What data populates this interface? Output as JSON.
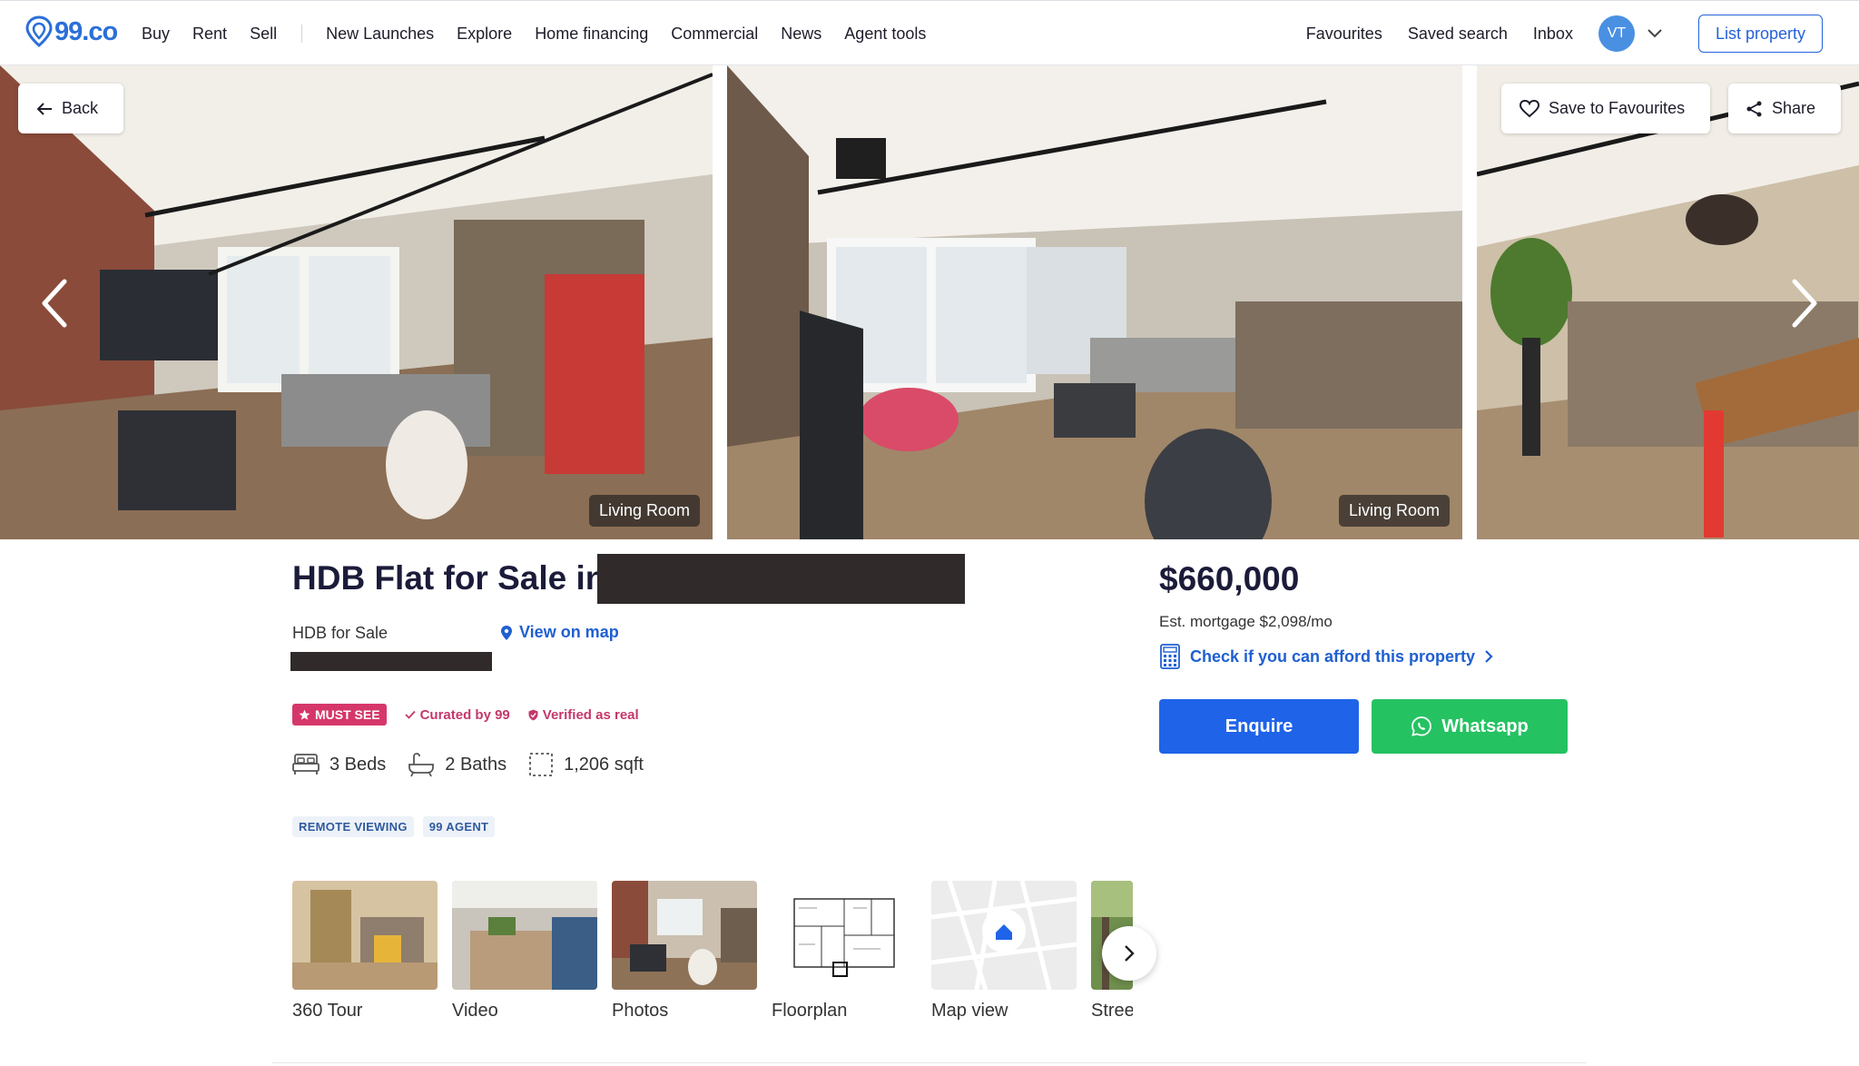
{
  "header": {
    "logo_text": "99.co",
    "nav": [
      "Buy",
      "Rent",
      "Sell"
    ],
    "nav2": [
      "New Launches",
      "Explore",
      "Home financing",
      "Commercial",
      "News",
      "Agent tools"
    ],
    "right": [
      "Favourites",
      "Saved search",
      "Inbox"
    ],
    "avatar_initials": "VT",
    "list_property": "List property"
  },
  "gallery": {
    "back": "Back",
    "save": "Save to Favourites",
    "share": "Share",
    "photos": [
      {
        "label": "Living Room"
      },
      {
        "label": "Living Room"
      },
      {
        "label": ""
      }
    ]
  },
  "listing": {
    "title": "HDB Flat for Sale in",
    "subtype": "HDB for Sale",
    "view_on_map": "View on map",
    "badge_must_see": "MUST SEE",
    "badge_curated": "Curated by 99",
    "badge_verified": "Verified as real",
    "beds": "3 Beds",
    "baths": "2 Baths",
    "area": "1,206 sqft",
    "tags": [
      "REMOTE VIEWING",
      "99 AGENT"
    ],
    "media": [
      "360 Tour",
      "Video",
      "Photos",
      "Floorplan",
      "Map view",
      "Stree"
    ]
  },
  "pricing": {
    "price": "$660,000",
    "mortgage": "Est. mortgage $2,098/mo",
    "afford": "Check if you can afford this property",
    "enquire": "Enquire",
    "whatsapp": "Whatsapp"
  },
  "colors": {
    "brand": "#2b6fd8",
    "enquire": "#1f64e8",
    "whatsapp": "#25c262",
    "must_see": "#d6376a"
  },
  "icons": [
    "logo-pin-icon",
    "chevron-down-icon",
    "arrow-left-icon",
    "heart-icon",
    "share-icon",
    "chevron-left-icon",
    "chevron-right-icon",
    "map-pin-icon",
    "star-icon",
    "check-icon",
    "shield-icon",
    "bed-icon",
    "bath-icon",
    "area-icon",
    "calculator-icon",
    "whatsapp-icon",
    "home-icon"
  ]
}
